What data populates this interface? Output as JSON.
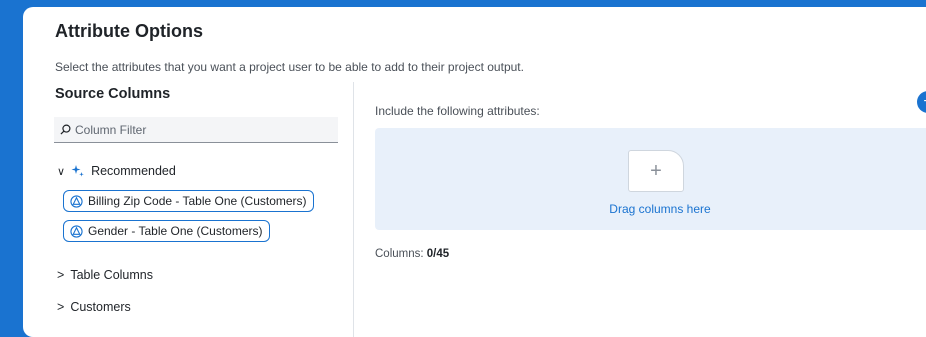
{
  "header": {
    "title": "Attribute Options",
    "subtitle": "Select the attributes that you want a project user to be able to add to their project output."
  },
  "source": {
    "title": "Source Columns",
    "filter_placeholder": "Column Filter",
    "recommended": {
      "label": "Recommended",
      "items": [
        {
          "label": "Billing Zip Code - Table One (Customers)"
        },
        {
          "label": "Gender - Table One (Customers)"
        }
      ]
    },
    "groups": [
      {
        "label": "Table Columns"
      },
      {
        "label": "Customers"
      }
    ]
  },
  "target": {
    "include_label": "Include the following attributes:",
    "add_button": "+",
    "drop_text": "Drag columns here",
    "columns_label": "Columns:",
    "columns_value": "0/45"
  },
  "colors": {
    "accent": "#1a73d0",
    "dropzone_bg": "#e8f0fa"
  },
  "icons": [
    "search-icon",
    "chevron-down-icon",
    "sparkle-icon",
    "attribute-icon",
    "plus-icon"
  ]
}
